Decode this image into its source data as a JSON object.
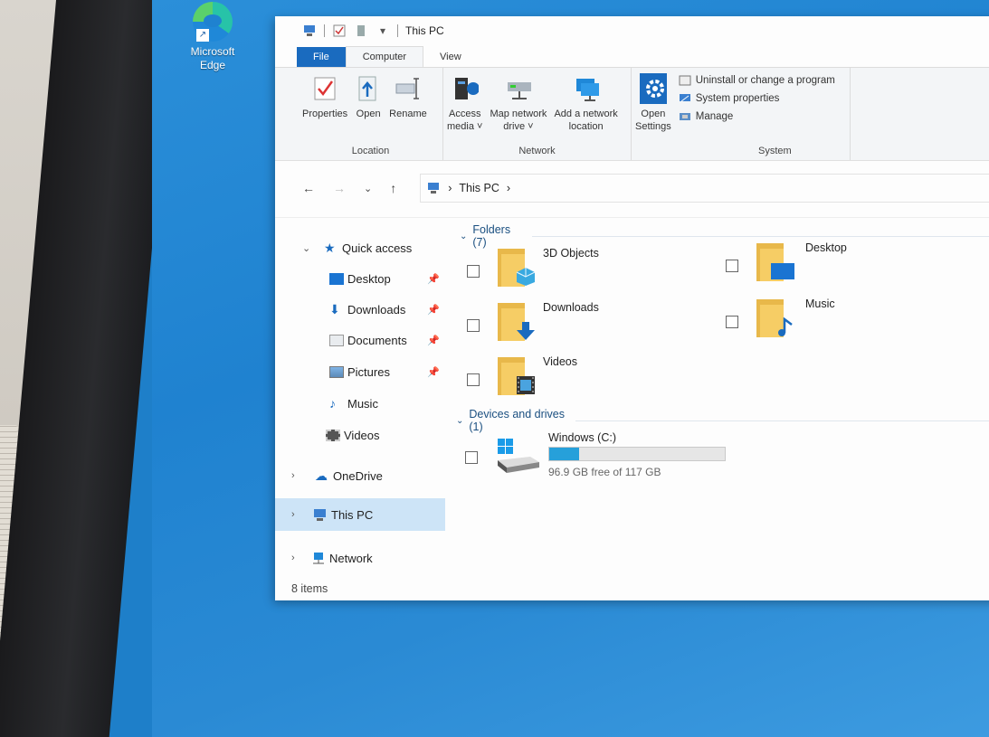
{
  "desktop": {
    "edge_label_line1": "Microsoft",
    "edge_label_line2": "Edge"
  },
  "window": {
    "title": "This PC",
    "tabs": [
      "File",
      "Computer",
      "View"
    ]
  },
  "ribbon": {
    "location": {
      "label": "Location",
      "buttons": [
        "Properties",
        "Open",
        "Rename"
      ]
    },
    "network": {
      "label": "Network",
      "access_media_line1": "Access",
      "access_media_line2": "media ˅",
      "map_drive_line1": "Map network",
      "map_drive_line2": "drive ˅",
      "add_location_line1": "Add a network",
      "add_location_line2": "location"
    },
    "system": {
      "label": "System",
      "open_settings_line1": "Open",
      "open_settings_line2": "Settings",
      "uninstall": "Uninstall or change a program",
      "system_properties": "System properties",
      "manage": "Manage"
    }
  },
  "address": {
    "path": "This PC"
  },
  "nav": {
    "quick_access": "Quick access",
    "desktop": "Desktop",
    "downloads": "Downloads",
    "documents": "Documents",
    "pictures": "Pictures",
    "music": "Music",
    "videos": "Videos",
    "onedrive": "OneDrive",
    "this_pc": "This PC",
    "network": "Network"
  },
  "content": {
    "folders_header": "Folders (7)",
    "folders": {
      "objects3d": "3D Objects",
      "desktop": "Desktop",
      "downloads": "Downloads",
      "music": "Music",
      "videos": "Videos"
    },
    "devices_header": "Devices and drives (1)",
    "drive": {
      "name": "Windows (C:)",
      "free_text": "96.9 GB free of 117 GB",
      "used_fraction": 0.17
    }
  },
  "status": {
    "items": "8 items"
  },
  "colors": {
    "accent": "#1a6bbf",
    "selected": "#cde4f7",
    "drive_fill": "#26a0da"
  }
}
